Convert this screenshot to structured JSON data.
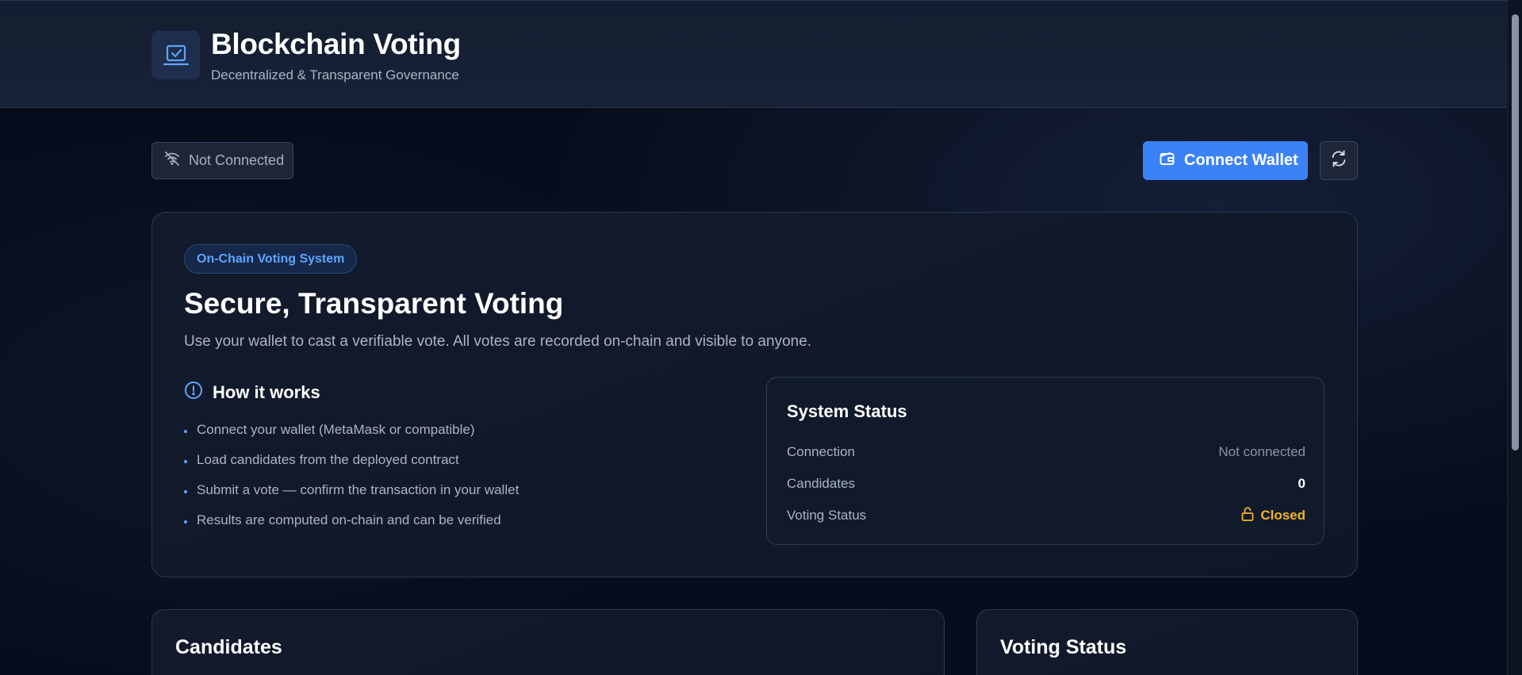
{
  "header": {
    "title": "Blockchain Voting",
    "subtitle": "Decentralized & Transparent Governance",
    "logo_icon": "ballot-laptop-icon"
  },
  "toolbar": {
    "connection_status": "Not Connected",
    "connection_icon": "wifi-off-icon",
    "connect_label": "Connect Wallet",
    "connect_icon": "wallet-icon",
    "refresh_icon": "refresh-icon"
  },
  "hero": {
    "tag": "On-Chain Voting System",
    "title": "Secure, Transparent Voting",
    "description": "Use your wallet to cast a verifiable vote. All votes are recorded on-chain and visible to anyone.",
    "how_title": "How it works",
    "how_icon": "info-circle-icon",
    "steps": [
      "Connect your wallet (MetaMask or compatible)",
      "Load candidates from the deployed contract",
      "Submit a vote — confirm the transaction in your wallet",
      "Results are computed on-chain and can be verified"
    ]
  },
  "system_status": {
    "title": "System Status",
    "rows": [
      {
        "label": "Connection",
        "value": "Not connected"
      },
      {
        "label": "Candidates",
        "value": "0"
      },
      {
        "label": "Voting Status",
        "value": "Closed"
      }
    ],
    "status_icon": "lock-open-icon"
  },
  "sections": {
    "candidates_title": "Candidates",
    "voting_status_title": "Voting Status"
  },
  "colors": {
    "accent": "#3b82f6",
    "tag_text": "#60a5fa",
    "warning": "#f5b323",
    "background": "#070d1c"
  }
}
